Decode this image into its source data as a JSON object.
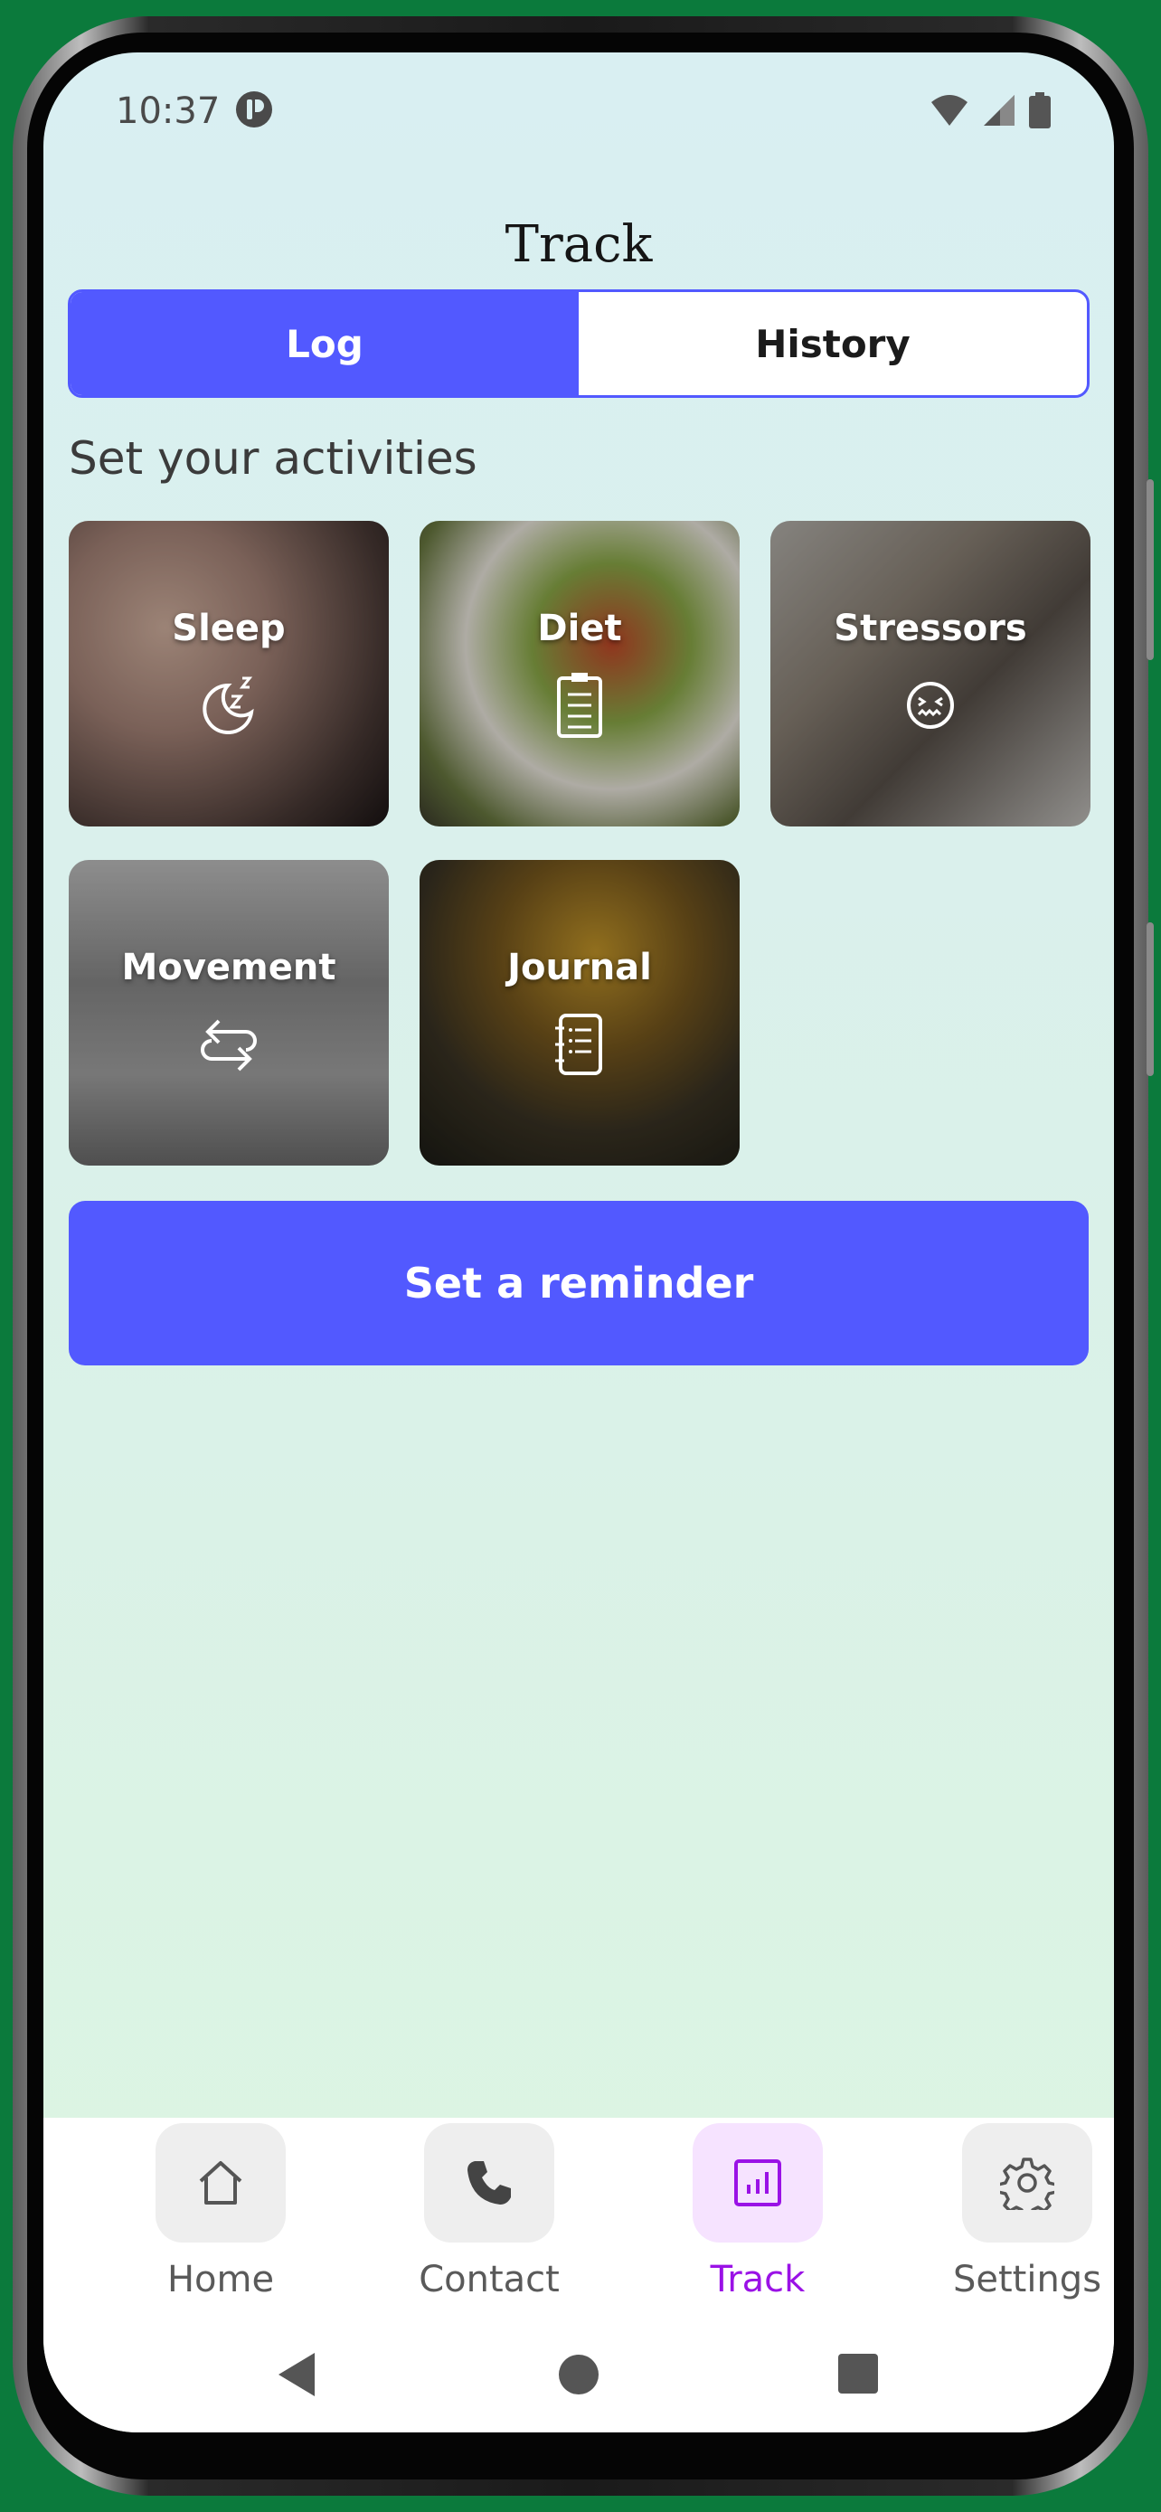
{
  "status_bar": {
    "time": "10:37",
    "icons": [
      "wifi-icon",
      "signal-icon",
      "battery-icon"
    ]
  },
  "header": {
    "title": "Track"
  },
  "tabs": [
    {
      "label": "Log",
      "active": true
    },
    {
      "label": "History",
      "active": false
    }
  ],
  "section": {
    "heading": "Set your activities"
  },
  "activities": [
    {
      "label": "Sleep",
      "icon": "moon-zzz-icon"
    },
    {
      "label": "Diet",
      "icon": "clipboard-icon"
    },
    {
      "label": "Stressors",
      "icon": "stressed-face-icon"
    },
    {
      "label": "Movement",
      "icon": "repeat-arrows-icon"
    },
    {
      "label": "Journal",
      "icon": "notebook-list-icon"
    }
  ],
  "reminder_button": {
    "label": "Set a reminder"
  },
  "bottom_nav": [
    {
      "label": "Home",
      "icon": "home-icon",
      "active": false
    },
    {
      "label": "Contact",
      "icon": "phone-icon",
      "active": false
    },
    {
      "label": "Track",
      "icon": "chart-icon",
      "active": true
    },
    {
      "label": "Settings",
      "icon": "gear-icon",
      "active": false
    }
  ],
  "colors": {
    "accent": "#5259ff",
    "active_nav": "#9a12e6",
    "device_background": "#0b7a3c"
  }
}
